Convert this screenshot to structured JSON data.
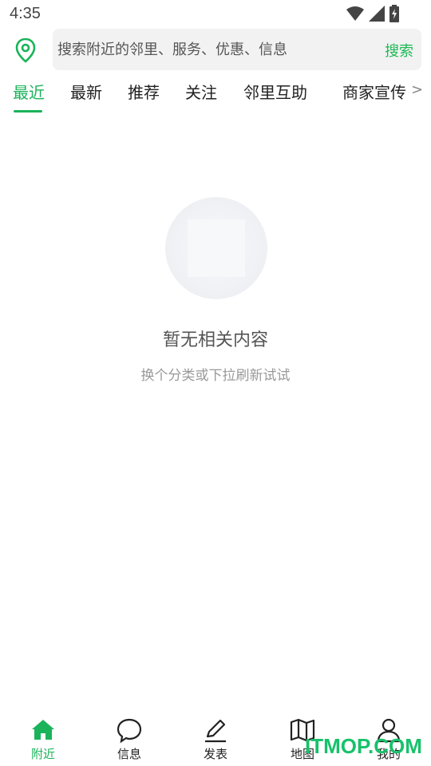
{
  "status_bar": {
    "time": "4:35",
    "icons": [
      "wifi-icon",
      "signal-icon",
      "battery-charging-icon"
    ]
  },
  "search": {
    "placeholder": "搜索附近的邻里、服务、优惠、信息",
    "button_label": "搜索",
    "location_icon": "location-pin-icon"
  },
  "tabs": [
    {
      "label": "最近",
      "active": true
    },
    {
      "label": "最新",
      "active": false
    },
    {
      "label": "推荐",
      "active": false
    },
    {
      "label": "关注",
      "active": false
    },
    {
      "label": "邻里互助",
      "active": false
    },
    {
      "label": "商家宣传",
      "active": false
    }
  ],
  "tabs_more": ">",
  "empty_state": {
    "title": "暂无相关内容",
    "subtitle": "换个分类或下拉刷新试试"
  },
  "bottom_nav": [
    {
      "label": "附近",
      "icon": "home-icon",
      "active": true
    },
    {
      "label": "信息",
      "icon": "chat-bubble-icon",
      "active": false
    },
    {
      "label": "发表",
      "icon": "pencil-icon",
      "active": false
    },
    {
      "label": "地图",
      "icon": "map-icon",
      "active": false
    },
    {
      "label": "我的",
      "icon": "user-icon",
      "active": false
    }
  ],
  "watermark": "ITMOP.COM",
  "colors": {
    "accent": "#1bb35a",
    "search_bg": "#f2f2f2",
    "text": "#222222",
    "muted": "#999999"
  }
}
